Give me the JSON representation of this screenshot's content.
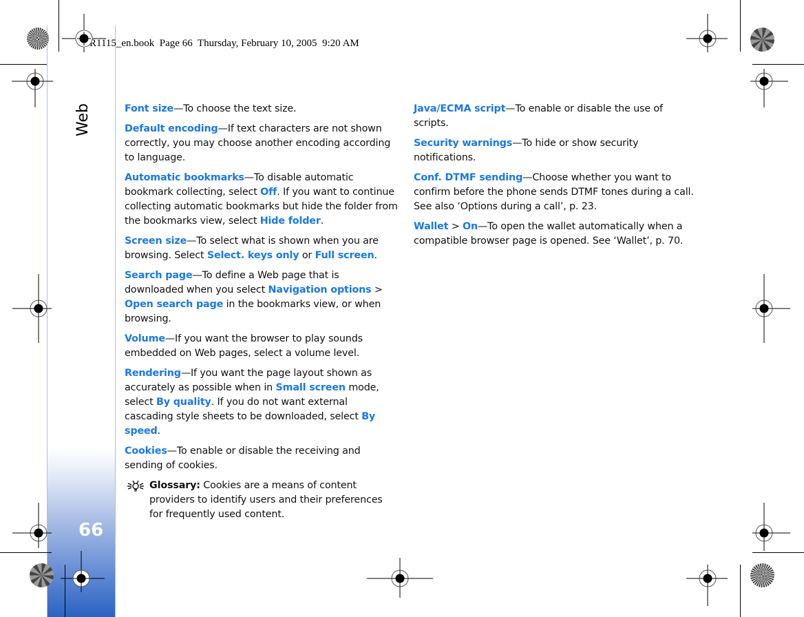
{
  "header": {
    "text": "R1115_en.book  Page 66  Thursday, February 10, 2005  9:20 AM"
  },
  "sidebar": {
    "chapter_title": "Web",
    "page_number": "66"
  },
  "colors": {
    "term": "#1a78e6",
    "tab_gradient_bottom": "#2a63c2",
    "tab_border": "#aebfdd"
  },
  "column_left": [
    {
      "term": "Font size",
      "text": "—To choose the text size."
    },
    {
      "term": "Default encoding",
      "text": "—If text characters are not shown correctly, you may choose another encoding according to language."
    },
    {
      "term": "Automatic bookmarks",
      "text_1": "—To disable automatic bookmark collecting, select ",
      "opt_1": "Off",
      "text_2": ". If you want to continue collecting automatic bookmarks but hide the folder from the bookmarks view, select ",
      "opt_2": "Hide folder",
      "text_3": "."
    },
    {
      "term": "Screen size",
      "text_1": "—To select what is shown when you are browsing. Select ",
      "opt_1": "Select. keys only",
      "text_2": " or ",
      "opt_2": "Full screen",
      "text_3": "."
    },
    {
      "term": "Search page",
      "text_1": "—To define a Web page that is downloaded when you select ",
      "opt_1": "Navigation options",
      "text_2": " > ",
      "opt_2": "Open search page",
      "text_3": " in the bookmarks view, or when browsing."
    },
    {
      "term": "Volume",
      "text": "—If you want the browser to play sounds embedded on Web pages, select a volume level."
    },
    {
      "term": "Rendering",
      "text_1": "—If you want the page layout shown as accurately as possible when in ",
      "opt_1": "Small screen",
      "text_2": " mode, select ",
      "opt_2": "By quality",
      "text_3": ". If you do not want external cascading style sheets to be downloaded, select ",
      "opt_3": "By speed",
      "text_4": "."
    },
    {
      "term": "Cookies",
      "text": "—To enable or disable the receiving and sending of cookies."
    }
  ],
  "glossary": {
    "icon": "lightbulb-tip-icon",
    "label": "Glossary:",
    "text": " Cookies are a means of content providers to identify users and their preferences for frequently used content."
  },
  "column_right": [
    {
      "term": "Java/ECMA script",
      "text": "—To enable or disable the use of scripts."
    },
    {
      "term": "Security warnings",
      "text": "—To hide or show security notifications."
    },
    {
      "term": "Conf. DTMF sending",
      "text": "—Choose whether you want to confirm before the phone sends DTMF tones during a call. See also ‘Options during a call’, p. 23."
    },
    {
      "term": "Wallet",
      "text_1": " > ",
      "opt_1": "On",
      "text_2": "—To open the wallet automatically when a compatible browser page is opened. See ‘Wallet’, p. 70."
    }
  ]
}
